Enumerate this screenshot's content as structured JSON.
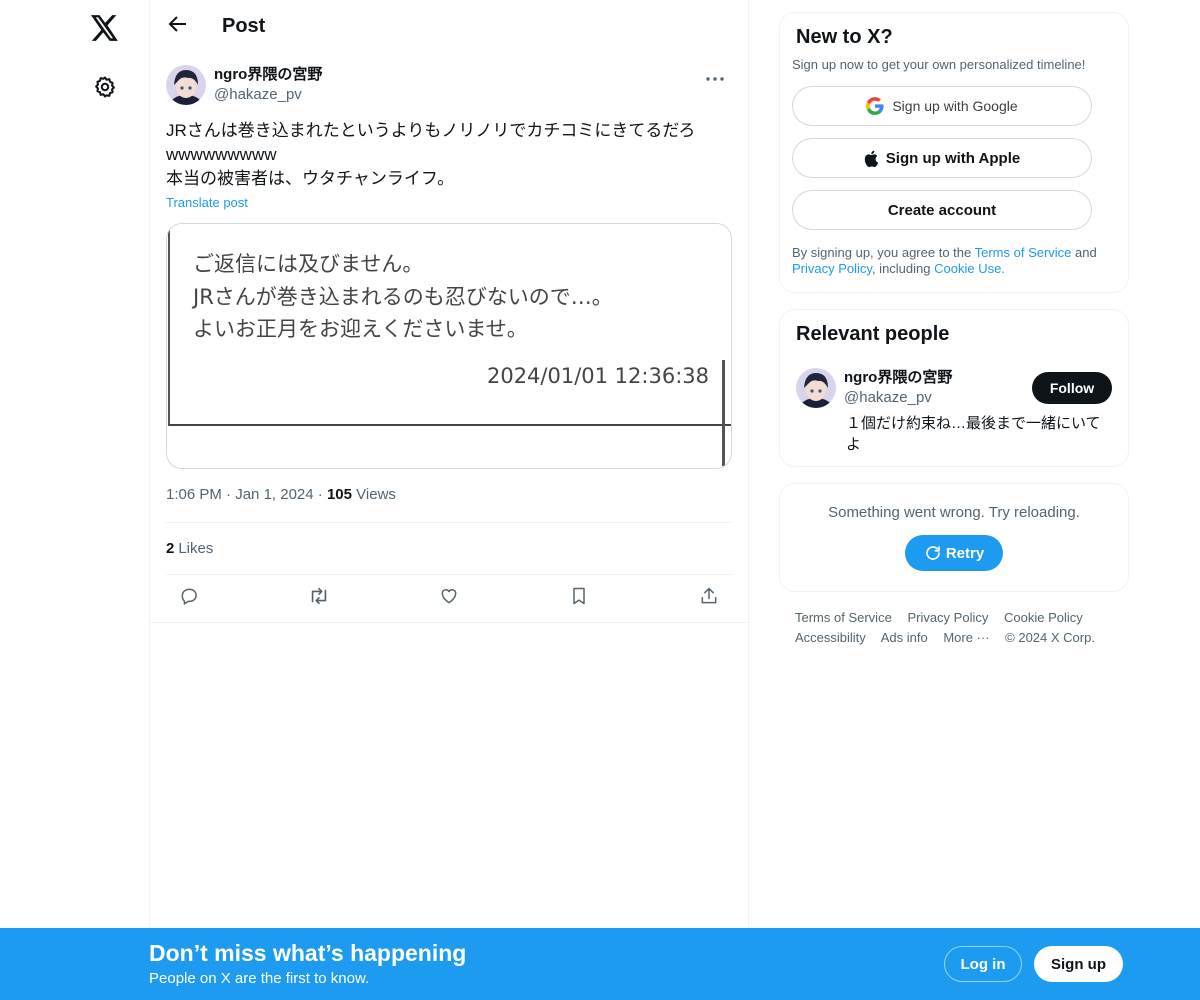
{
  "icons": {
    "logo": "x-logo-icon",
    "settings": "gear-icon",
    "back": "arrow-left-icon",
    "more": "more-horizontal-icon",
    "reply": "reply-icon",
    "repost": "repost-icon",
    "like": "heart-icon",
    "bookmark": "bookmark-icon",
    "share": "share-icon",
    "google": "google-icon",
    "apple": "apple-icon",
    "retry": "refresh-icon"
  },
  "colors": {
    "accent": "#1d9bf0",
    "text": "#0f1419",
    "secondary": "#536471",
    "border": "#eff3f4"
  },
  "header": {
    "title": "Post"
  },
  "post": {
    "author_name": "ngro界隈の宮野",
    "author_handle": "@hakaze_pv",
    "text": "JRさんは巻き込まれたというよりもノリノリでカチコミにきてるだろ\nwwwwwwwww\n本当の被害者は、ウタチャンライフ。",
    "translate_label": "Translate post",
    "media": {
      "line1": "ご返信には及びません。",
      "line2": "JRさんが巻き込まれるのも忍びないので…。",
      "line3": "よいお正月をお迎えくださいませ。",
      "date": "2024/01/01 12:36:38"
    },
    "time": "1:06 PM",
    "date": "Jan 1, 2024",
    "views_count": "105",
    "views_label": "Views",
    "likes_count": "2",
    "likes_label": "Likes"
  },
  "signup_card": {
    "title": "New to X?",
    "subtitle": "Sign up now to get your own personalized timeline!",
    "google_label": "Sign up with Google",
    "apple_label": "Sign up with Apple",
    "create_label": "Create account",
    "legal_prefix": "By signing up, you agree to the ",
    "terms_link": "Terms of Service",
    "legal_and": " and ",
    "privacy_link": "Privacy Policy",
    "legal_including": ", including ",
    "cookie_link": "Cookie Use."
  },
  "relevant": {
    "title": "Relevant people",
    "name": "ngro界隈の宮野",
    "handle": "@hakaze_pv",
    "bio": "１個だけ約束ね…最後まで一緒にいてよ",
    "follow_label": "Follow"
  },
  "error_card": {
    "message": "Something went wrong. Try reloading.",
    "retry_label": "Retry"
  },
  "footer": {
    "terms": "Terms of Service",
    "privacy": "Privacy Policy",
    "cookie": "Cookie Policy",
    "accessibility": "Accessibility",
    "ads": "Ads info",
    "more": "More ···",
    "copyright": "© 2024 X Corp."
  },
  "bottom_bar": {
    "title": "Don’t miss what’s happening",
    "subtitle": "People on X are the first to know.",
    "login_label": "Log in",
    "signup_label": "Sign up"
  }
}
